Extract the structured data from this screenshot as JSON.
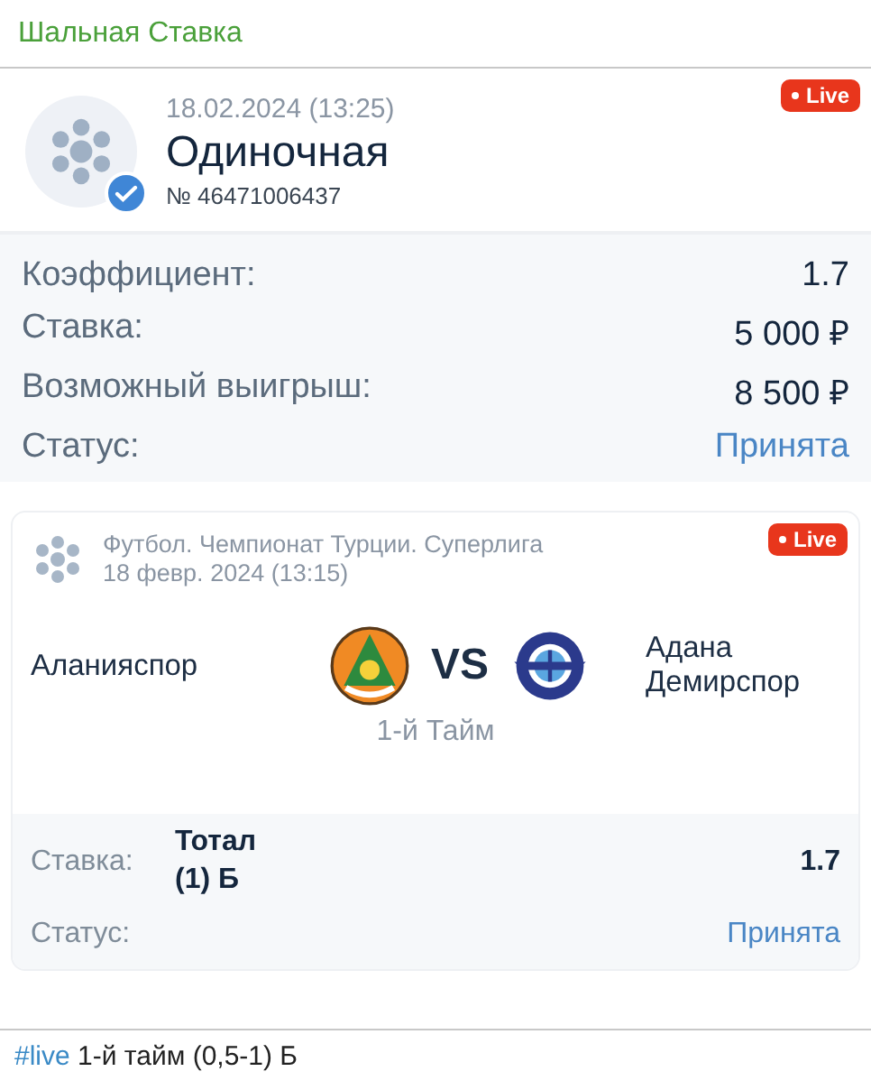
{
  "channel": {
    "title": "Шальная Ставка"
  },
  "bet": {
    "date": "18.02.2024 (13:25)",
    "type": "Одиночная",
    "number": "№ 46471006437",
    "live_badge": "Live",
    "verified": true
  },
  "summary": [
    {
      "label": "Коэффициент:",
      "value": "1.7",
      "kind": "value"
    },
    {
      "label": "Ставка:",
      "value": "5 000 ₽",
      "kind": "value"
    },
    {
      "label": "Возможный выигрыш:",
      "value": "8 500 ₽",
      "kind": "value"
    },
    {
      "label": "Статус:",
      "value": "Принята",
      "kind": "status"
    }
  ],
  "event": {
    "league": "Футбол. Чемпионат Турции. Суперлига",
    "date": "18 февр. 2024 (13:15)",
    "live_badge": "Live",
    "team_home": "Аланияспор",
    "vs": "VS",
    "team_away": "Адана Демирспор",
    "period": "1-й Тайм",
    "rows": [
      {
        "label": "Ставка:",
        "value": "Тотал (1) Б",
        "odds": "1.7",
        "kind": "pick"
      },
      {
        "label": "Статус:",
        "value": "Принята",
        "kind": "status"
      }
    ]
  },
  "caption": {
    "hashtag": "#live",
    "text": "1-й тайм (0,5-1) Б"
  }
}
